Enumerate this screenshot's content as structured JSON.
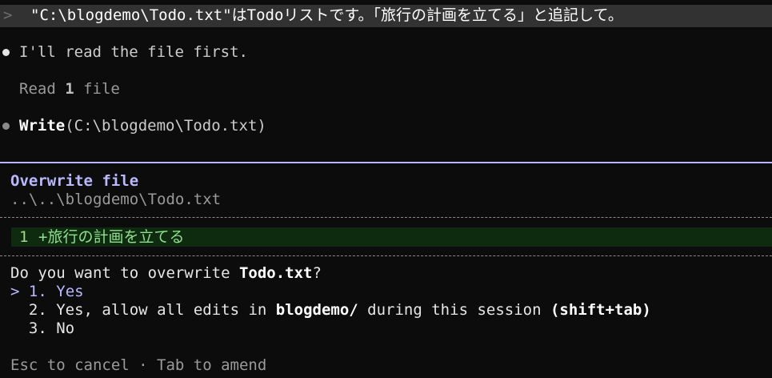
{
  "prompt": {
    "caret": ">",
    "text": "\"C:\\blogdemo\\Todo.txt\"はTodoリストです。「旅行の計画を立てる」と追記して。"
  },
  "messages": {
    "assistant_note": "I'll read the file first.",
    "read_prefix": "Read ",
    "read_count": "1",
    "read_suffix": " file",
    "tool_name": "Write",
    "tool_args": "(C:\\blogdemo\\Todo.txt)"
  },
  "dialog": {
    "title": "Overwrite file",
    "path": "..\\..\\blogdemo\\Todo.txt",
    "diff": {
      "line_number": "1",
      "marker": "+",
      "content": "旅行の計画を立てる"
    },
    "question_prefix": "Do you want to overwrite ",
    "question_file": "Todo.txt",
    "question_suffix": "?",
    "selector": ">",
    "options": [
      {
        "number": "1.",
        "label": "Yes"
      },
      {
        "number": "2.",
        "label_prefix": "Yes, allow all edits in ",
        "label_folder": "blogdemo/",
        "label_mid": " during this session ",
        "label_shortcut": "(shift+tab)"
      },
      {
        "number": "3.",
        "label": "No"
      }
    ],
    "footer": "Esc to cancel · Tab to amend"
  },
  "colors": {
    "background": "#0c0c0c",
    "accent": "#b9b9ff",
    "diff_bg": "#0e2b10",
    "diff_text": "#8fe08f"
  }
}
